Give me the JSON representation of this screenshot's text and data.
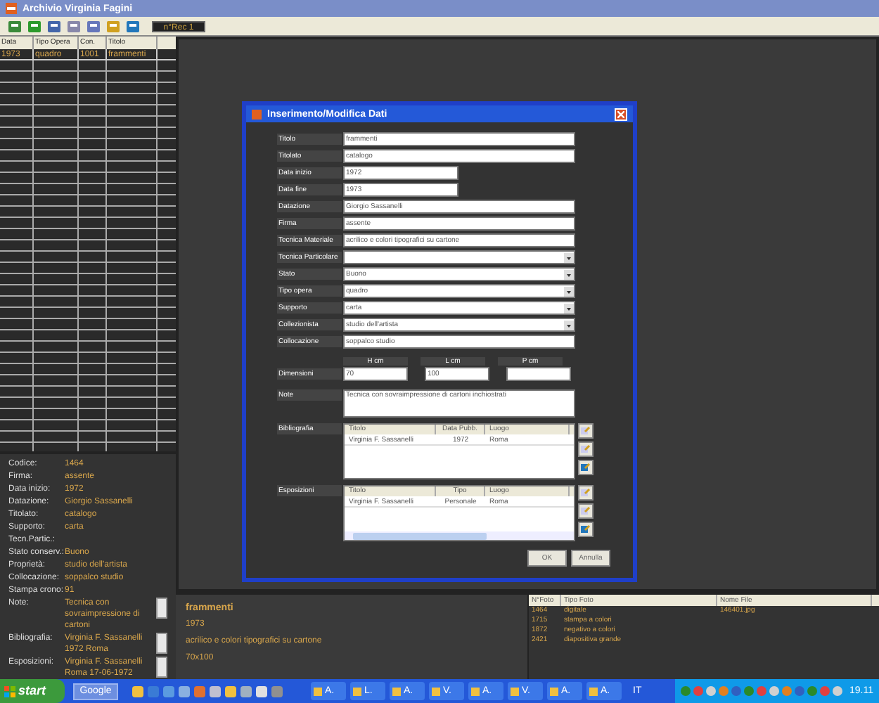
{
  "window": {
    "title": "Archivio Virginia Fagini"
  },
  "toolbar": {
    "record": "n°Rec 1"
  },
  "grid": {
    "columns": [
      "Data",
      "Tipo Opera",
      "Con.",
      "Titolo"
    ],
    "rows": [
      [
        "1973",
        "quadro",
        "1001",
        "frammenti"
      ]
    ]
  },
  "details": [
    {
      "label": "Codice:",
      "value": "1464"
    },
    {
      "label": "Firma:",
      "value": "assente"
    },
    {
      "label": "Data inizio:",
      "value": "1972"
    },
    {
      "label": "Datazione:",
      "value": "Giorgio Sassanelli"
    },
    {
      "label": "Titolato:",
      "value": "catalogo"
    },
    {
      "label": "Supporto:",
      "value": "carta"
    },
    {
      "label": "Tecn.Partic.:"
    },
    {
      "label": "Stato conserv.:",
      "value": "Buono"
    },
    {
      "label": "Proprietà:",
      "value": "studio dell'artista"
    },
    {
      "label": "Collocazione:",
      "value": "soppalco studio"
    },
    {
      "label": "Stampa crono:",
      "value": "91"
    },
    {
      "label": "Note:",
      "value": "Tecnica con sovraimpressione di cartoni",
      "scroll": true
    },
    {
      "label": "Bibliografia:",
      "value": "Virginia F. Sassanelli 1972 Roma",
      "scroll": true
    },
    {
      "label": "Esposizioni:",
      "value": "Virginia F. Sassanelli Roma 17-06-1972",
      "scroll": true
    }
  ],
  "dialog": {
    "title": "Inserimento/Modifica Dati",
    "fields": [
      {
        "label": "Titolo",
        "kind": "text",
        "value": "frammenti"
      },
      {
        "label": "Titolato",
        "kind": "text",
        "value": "catalogo"
      },
      {
        "label": "Data inizio",
        "kind": "short",
        "value": "1972"
      },
      {
        "label": "Data fine",
        "kind": "short",
        "value": "1973"
      },
      {
        "label": "Datazione",
        "kind": "text",
        "value": "Giorgio Sassanelli"
      },
      {
        "label": "Firma",
        "kind": "text",
        "value": "assente"
      },
      {
        "label": "Tecnica Materiale",
        "kind": "text",
        "value": "acrilico e colori tipografici su cartone"
      },
      {
        "label": "Tecnica Particolare",
        "kind": "select"
      },
      {
        "label": "Stato",
        "kind": "select",
        "value": "Buono"
      },
      {
        "label": "Tipo opera",
        "kind": "select",
        "value": "quadro"
      },
      {
        "label": "Supporto",
        "kind": "select",
        "value": "carta"
      },
      {
        "label": "Collezionista",
        "kind": "select",
        "value": "studio dell'artista"
      },
      {
        "label": "Collocazione",
        "kind": "text",
        "value": "soppalco studio"
      }
    ],
    "dimensions": {
      "label": "Dimensioni",
      "items": [
        {
          "header": "H cm",
          "value": "70"
        },
        {
          "header": "L cm",
          "value": "100"
        },
        {
          "header": "P cm"
        }
      ]
    },
    "note": {
      "label": "Note",
      "value": "Tecnica con sovraimpressione di cartoni inchiostrati"
    },
    "tables": [
      {
        "label": "Bibliografia",
        "columns": [
          "Titolo",
          "Data Pubb.",
          "Luogo"
        ],
        "rows": [
          [
            "Virginia F. Sassanelli",
            "1972",
            "Roma"
          ]
        ],
        "scrollbar": false
      },
      {
        "label": "Esposizioni",
        "columns": [
          "Titolo",
          "Tipo",
          "Luogo"
        ],
        "rows": [
          [
            "Virginia F. Sassanelli",
            "Personale",
            "Roma"
          ]
        ],
        "scrollbar": true
      }
    ],
    "buttons": [
      "OK",
      "Annulla"
    ]
  },
  "summary": {
    "title": "frammenti",
    "lines": [
      "1973",
      "acrilico e colori tipografici su cartone",
      "70x100"
    ]
  },
  "photos": {
    "columns": [
      "N°Foto",
      "Tipo Foto",
      "Nome File"
    ],
    "rows": [
      [
        "1464",
        "digitale",
        "146401.jpg"
      ],
      [
        "1715",
        "stampa a colori"
      ],
      [
        "1872",
        "negativo a colori"
      ],
      [
        "2421",
        "diapositiva grande"
      ]
    ]
  },
  "taskbar": {
    "start": "start",
    "search": "Google",
    "tasks": [
      "A.",
      "L.",
      "A.",
      "V.",
      "A.",
      "V.",
      "A.",
      "A."
    ],
    "language": "IT",
    "clock": "19.11"
  }
}
